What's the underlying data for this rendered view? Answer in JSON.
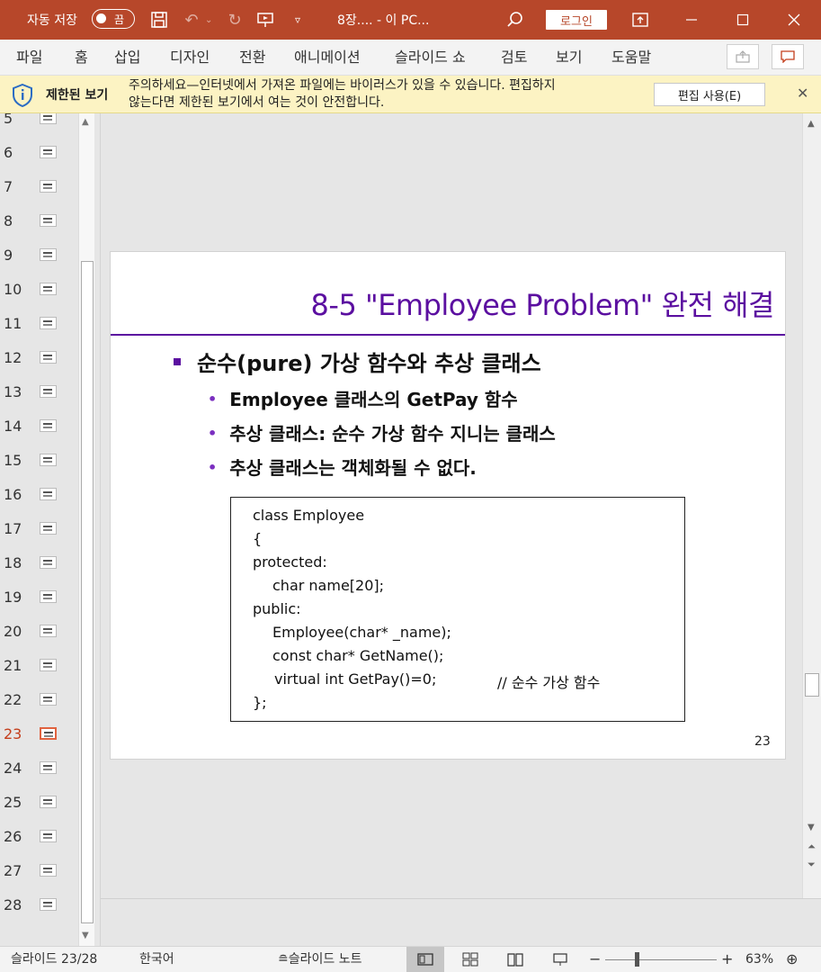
{
  "titlebar": {
    "autosave_label": "자동 저장",
    "autosave_state": "끔",
    "doc_title": "8장....  - 이 PC...",
    "login_label": "로그인"
  },
  "menu": {
    "items": [
      "파일",
      "홈",
      "삽입",
      "디자인",
      "전환",
      "애니메이션",
      "슬라이드 쇼",
      "검토",
      "보기",
      "도움말"
    ]
  },
  "infobar": {
    "title": "제한된 보기",
    "message_line1": "주의하세요—인터넷에서 가져온 파일에는 바이러스가 있을 수 있습니다. 편집하지",
    "message_line2": "않는다면 제한된 보기에서 여는 것이 안전합니다.",
    "enable_button": "편집 사용(E)"
  },
  "thumbnails": {
    "numbers": [
      "5",
      "6",
      "7",
      "8",
      "9",
      "10",
      "11",
      "12",
      "13",
      "14",
      "15",
      "16",
      "17",
      "18",
      "19",
      "20",
      "21",
      "22",
      "23",
      "24",
      "25",
      "26",
      "27",
      "28"
    ],
    "active": "23"
  },
  "slide": {
    "title": "8-5  \"Employee Problem\" 완전 해결",
    "bullet1": "순수(pure) 가상 함수와 추상 클래스",
    "sub_bullets": [
      "Employee 클래스의 GetPay 함수",
      "추상 클래스: 순수 가상 함수 지니는 클래스",
      "추상 클래스는 객체화될 수 없다."
    ],
    "code": [
      "class Employee",
      "{",
      "protected:",
      "char name[20];",
      "public:",
      "Employee(char* _name);",
      "const char* GetName();",
      "virtual int GetPay()=0;",
      "// 순수 가상 함수",
      "};"
    ],
    "page_number": "23"
  },
  "statusbar": {
    "slide_info": "슬라이드 23/28",
    "language": "한국어",
    "notes_label": "슬라이드 노트",
    "zoom": "63%"
  },
  "colors": {
    "titlebar": "#b7472a",
    "slide_title": "#5b0fa0",
    "infobar": "#fcf3c3"
  }
}
